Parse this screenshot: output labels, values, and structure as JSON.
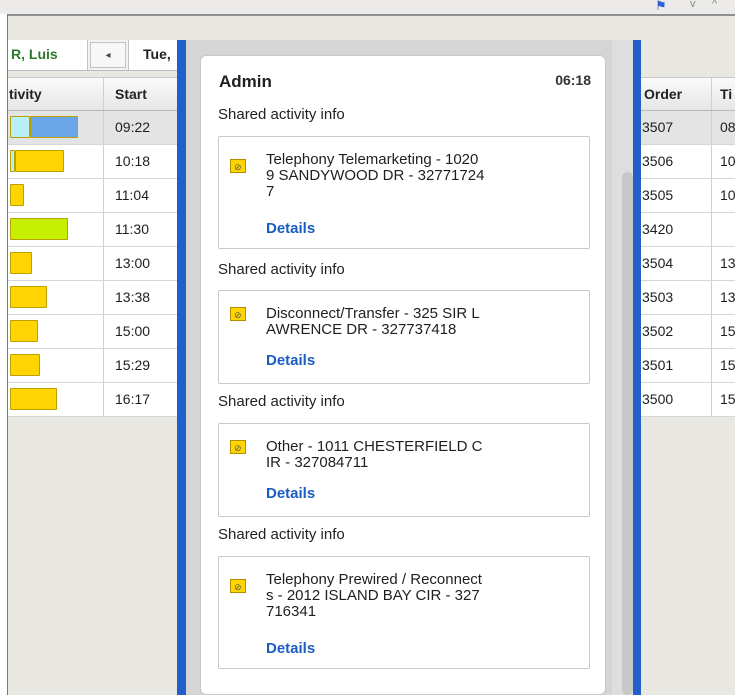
{
  "browser": {
    "bookmark_icon": "bookmark-icon",
    "chevrons": [
      "v",
      "^"
    ]
  },
  "left_tabs": {
    "resource": "R, Luis",
    "arrow": "◂",
    "date": "Tue,"
  },
  "left_columns": {
    "activity": "tivity",
    "start": "Start"
  },
  "left_rows": [
    {
      "start": "09:22",
      "bar_colors": [
        "#b8eef5",
        "#6aa6e8"
      ],
      "bar_fills": [
        0.3,
        0.7
      ]
    },
    {
      "start": "10:18",
      "bar_colors": [
        "#b8eef5",
        "#ffd400"
      ],
      "bar_fills": [
        0.1,
        0.9
      ]
    },
    {
      "start": "11:04",
      "bar_colors": [
        "#ffd400"
      ],
      "bar_fills": [
        1
      ]
    },
    {
      "start": "11:30",
      "bar_colors": [
        "#c6f000"
      ],
      "bar_fills": [
        1
      ]
    },
    {
      "start": "13:00",
      "bar_colors": [
        "#ffd400"
      ],
      "bar_fills": [
        1
      ]
    },
    {
      "start": "13:38",
      "bar_colors": [
        "#ffd400"
      ],
      "bar_fills": [
        1
      ]
    },
    {
      "start": "15:00",
      "bar_colors": [
        "#ffd400"
      ],
      "bar_fills": [
        1
      ]
    },
    {
      "start": "15:29",
      "bar_colors": [
        "#ffd400"
      ],
      "bar_fills": [
        1
      ]
    },
    {
      "start": "16:17",
      "bar_colors": [
        "#ffd400"
      ],
      "bar_fills": [
        1
      ]
    }
  ],
  "right_columns": {
    "order": "Order",
    "time": "Ti"
  },
  "right_rows": [
    {
      "order": "3507",
      "time": "08"
    },
    {
      "order": "3506",
      "time": "10"
    },
    {
      "order": "3505",
      "time": "10"
    },
    {
      "order": "3420",
      "time": ""
    },
    {
      "order": "3504",
      "time": "13"
    },
    {
      "order": "3503",
      "time": "13"
    },
    {
      "order": "3502",
      "time": "15"
    },
    {
      "order": "3501",
      "time": "15"
    },
    {
      "order": "3500",
      "time": "15"
    }
  ],
  "popup": {
    "title": "Admin",
    "time": "06:18",
    "sections": [
      {
        "heading": "Shared activity info",
        "text": "Telephony Telemarketing - 1020\n9 SANDYWOOD DR - 32771724\n7",
        "link": "Details"
      },
      {
        "heading": "Shared activity info",
        "text": "Disconnect/Transfer - 325 SIR L\nAWRENCE DR - 327737418",
        "link": "Details"
      },
      {
        "heading": "Shared activity info",
        "text": "Other - 1011 CHESTERFIELD C\nIR - 327084711",
        "link": "Details"
      },
      {
        "heading": "Shared activity info",
        "text": "Telephony Prewired / Reconnect\ns - 2012 ISLAND BAY CIR - 327\n716341",
        "link": "Details"
      }
    ]
  },
  "colors": {
    "accent_blue": "#2060c8",
    "link": "#1a5ec4",
    "resource_green": "#2b7a2b"
  }
}
